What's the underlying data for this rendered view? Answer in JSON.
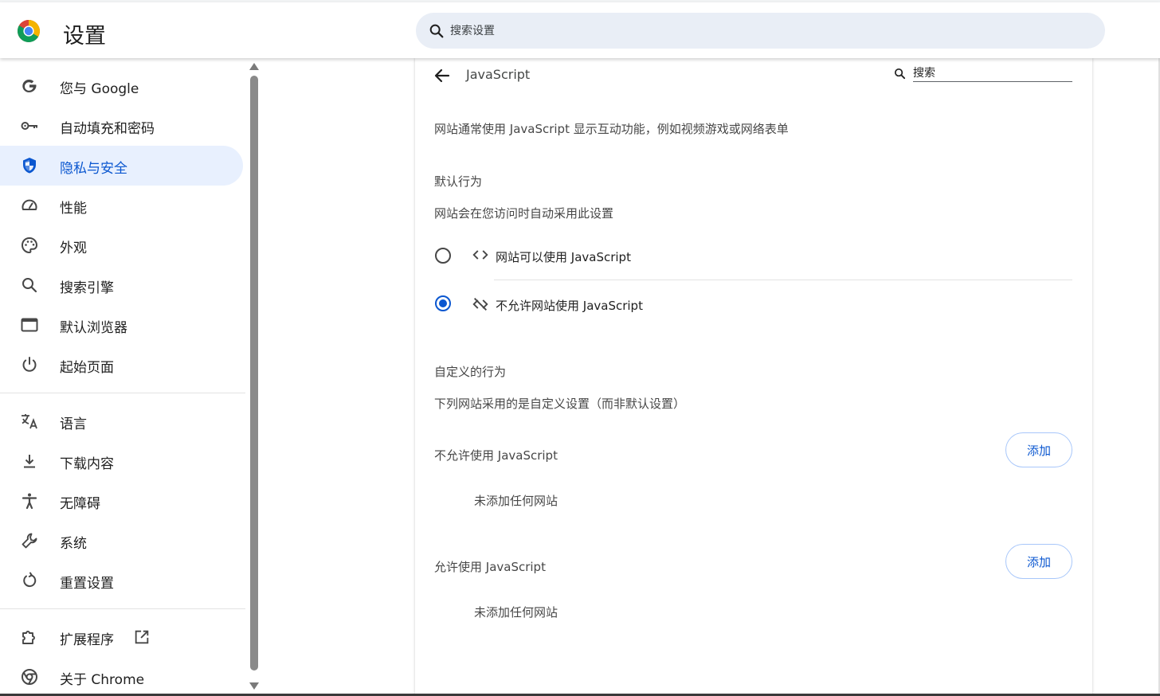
{
  "header": {
    "app_title": "设置",
    "search_placeholder": "搜索设置"
  },
  "sidebar": {
    "items": [
      {
        "label": "您与 Google",
        "icon": "google-g-icon"
      },
      {
        "label": "自动填充和密码",
        "icon": "key-icon"
      },
      {
        "label": "隐私与安全",
        "icon": "shield-icon",
        "active": true
      },
      {
        "label": "性能",
        "icon": "speedometer-icon"
      },
      {
        "label": "外观",
        "icon": "palette-icon"
      },
      {
        "label": "搜索引擎",
        "icon": "search-icon"
      },
      {
        "label": "默认浏览器",
        "icon": "browser-window-icon"
      },
      {
        "label": "起始页面",
        "icon": "power-icon"
      },
      {
        "label": "语言",
        "icon": "translate-icon"
      },
      {
        "label": "下载内容",
        "icon": "download-icon"
      },
      {
        "label": "无障碍",
        "icon": "accessibility-icon"
      },
      {
        "label": "系统",
        "icon": "wrench-icon"
      },
      {
        "label": "重置设置",
        "icon": "reset-icon"
      },
      {
        "label": "扩展程序",
        "icon": "puzzle-icon"
      },
      {
        "label": "关于 Chrome",
        "icon": "chrome-icon"
      }
    ]
  },
  "content": {
    "title": "JavaScript",
    "search_placeholder": "搜索",
    "description": "网站通常使用 JavaScript 显示互动功能，例如视频游戏或网络表单",
    "default_behavior": {
      "heading": "默认行为",
      "subtitle": "网站会在您访问时自动采用此设置",
      "options": [
        {
          "label": "网站可以使用 JavaScript",
          "icon": "code-icon",
          "selected": false
        },
        {
          "label": "不允许网站使用 JavaScript",
          "icon": "code-off-icon",
          "selected": true
        }
      ]
    },
    "custom_behavior": {
      "heading": "自定义的行为",
      "subtitle": "下列网站采用的是自定义设置（而非默认设置）",
      "lists": [
        {
          "label": "不允许使用 JavaScript",
          "add_label": "添加",
          "empty_text": "未添加任何网站"
        },
        {
          "label": "允许使用 JavaScript",
          "add_label": "添加",
          "empty_text": "未添加任何网站"
        }
      ]
    }
  },
  "colors": {
    "accent": "#0b57d0",
    "active_bg": "#e8f0fe",
    "search_bg": "#e9eef6"
  }
}
